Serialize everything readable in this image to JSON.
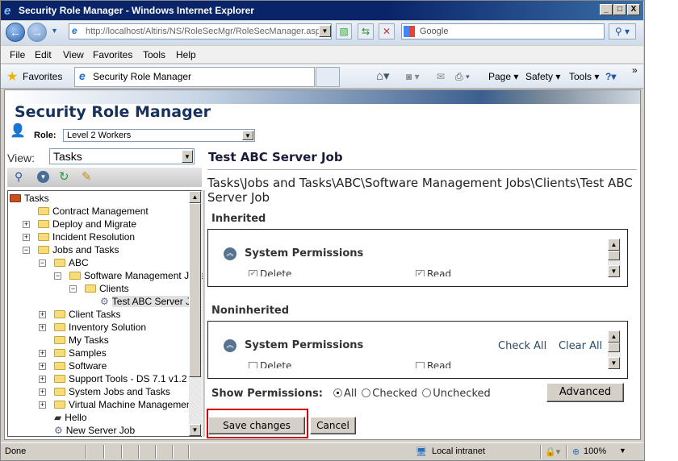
{
  "window": {
    "title": "Security Role Manager - Windows Internet Explorer",
    "min": "_",
    "max": "□",
    "close": "X"
  },
  "nav": {
    "back": "←",
    "forward": "→",
    "url": "http://localhost/Altiris/NS/RoleSecMgr/RoleSecManager.asp",
    "search_placeholder": "Google"
  },
  "menu": [
    "File",
    "Edit",
    "View",
    "Favorites",
    "Tools",
    "Help"
  ],
  "favorites": {
    "label": "Favorites",
    "tab": "Security Role Manager",
    "commands": [
      "Page ▾",
      "Safety ▾",
      "Tools ▾"
    ]
  },
  "app": {
    "title": "Security Role Manager",
    "role_label": "Role:",
    "role_value": "Level 2 Workers",
    "view_label": "View:",
    "view_value": "Tasks"
  },
  "tree": [
    {
      "label": "Tasks",
      "level": 0,
      "exp": "",
      "icon": "root"
    },
    {
      "label": "Contract Management",
      "level": 1,
      "exp": "",
      "icon": "folder"
    },
    {
      "label": "Deploy and Migrate",
      "level": 1,
      "exp": "+",
      "icon": "folder"
    },
    {
      "label": "Incident Resolution",
      "level": 1,
      "exp": "+",
      "icon": "folder"
    },
    {
      "label": "Jobs and Tasks",
      "level": 1,
      "exp": "-",
      "icon": "folder"
    },
    {
      "label": "ABC",
      "level": 2,
      "exp": "-",
      "icon": "folder"
    },
    {
      "label": "Software Management Jobs",
      "level": 3,
      "exp": "-",
      "icon": "folder"
    },
    {
      "label": "Clients",
      "level": 4,
      "exp": "-",
      "icon": "folder"
    },
    {
      "label": "Test ABC Server Job",
      "level": 5,
      "exp": "",
      "icon": "job",
      "selected": true
    },
    {
      "label": "Client Tasks",
      "level": 2,
      "exp": "+",
      "icon": "folder"
    },
    {
      "label": "Inventory Solution",
      "level": 2,
      "exp": "+",
      "icon": "folder"
    },
    {
      "label": "My Tasks",
      "level": 2,
      "exp": "",
      "icon": "folder"
    },
    {
      "label": "Samples",
      "level": 2,
      "exp": "+",
      "icon": "folder"
    },
    {
      "label": "Software",
      "level": 2,
      "exp": "+",
      "icon": "folder"
    },
    {
      "label": "Support Tools - DS 7.1 v1.2",
      "level": 2,
      "exp": "+",
      "icon": "folder"
    },
    {
      "label": "System Jobs and Tasks",
      "level": 2,
      "exp": "+",
      "icon": "folder"
    },
    {
      "label": "Virtual Machine Management",
      "level": 2,
      "exp": "+",
      "icon": "folder"
    },
    {
      "label": "Hello",
      "level": 2,
      "exp": "",
      "icon": "doc"
    },
    {
      "label": "New Server Job",
      "level": 2,
      "exp": "",
      "icon": "job"
    }
  ],
  "detail": {
    "title": "Test ABC Server Job",
    "path": "Tasks\\Jobs and Tasks\\ABC\\Software Management Jobs\\Clients\\Test ABC Server Job",
    "inherited": {
      "heading": "Inherited",
      "group": "System Permissions",
      "perms": [
        {
          "label": "Delete",
          "checked": true
        },
        {
          "label": "Read",
          "checked": true
        }
      ]
    },
    "noninherited": {
      "heading": "Noninherited",
      "group": "System Permissions",
      "check_all": "Check All",
      "clear_all": "Clear All",
      "perms": [
        {
          "label": "Delete",
          "checked": false
        },
        {
          "label": "Read",
          "checked": false
        }
      ]
    },
    "show_label": "Show Permissions:",
    "show_options": [
      "All",
      "Checked",
      "Unchecked"
    ],
    "show_selected": "All",
    "advanced": "Advanced",
    "save": "Save changes",
    "cancel": "Cancel"
  },
  "status": {
    "text": "Done",
    "zone": "Local intranet",
    "zoom": "100%"
  },
  "colors": {
    "highlight": "#cc0000",
    "title": "#16325c"
  }
}
